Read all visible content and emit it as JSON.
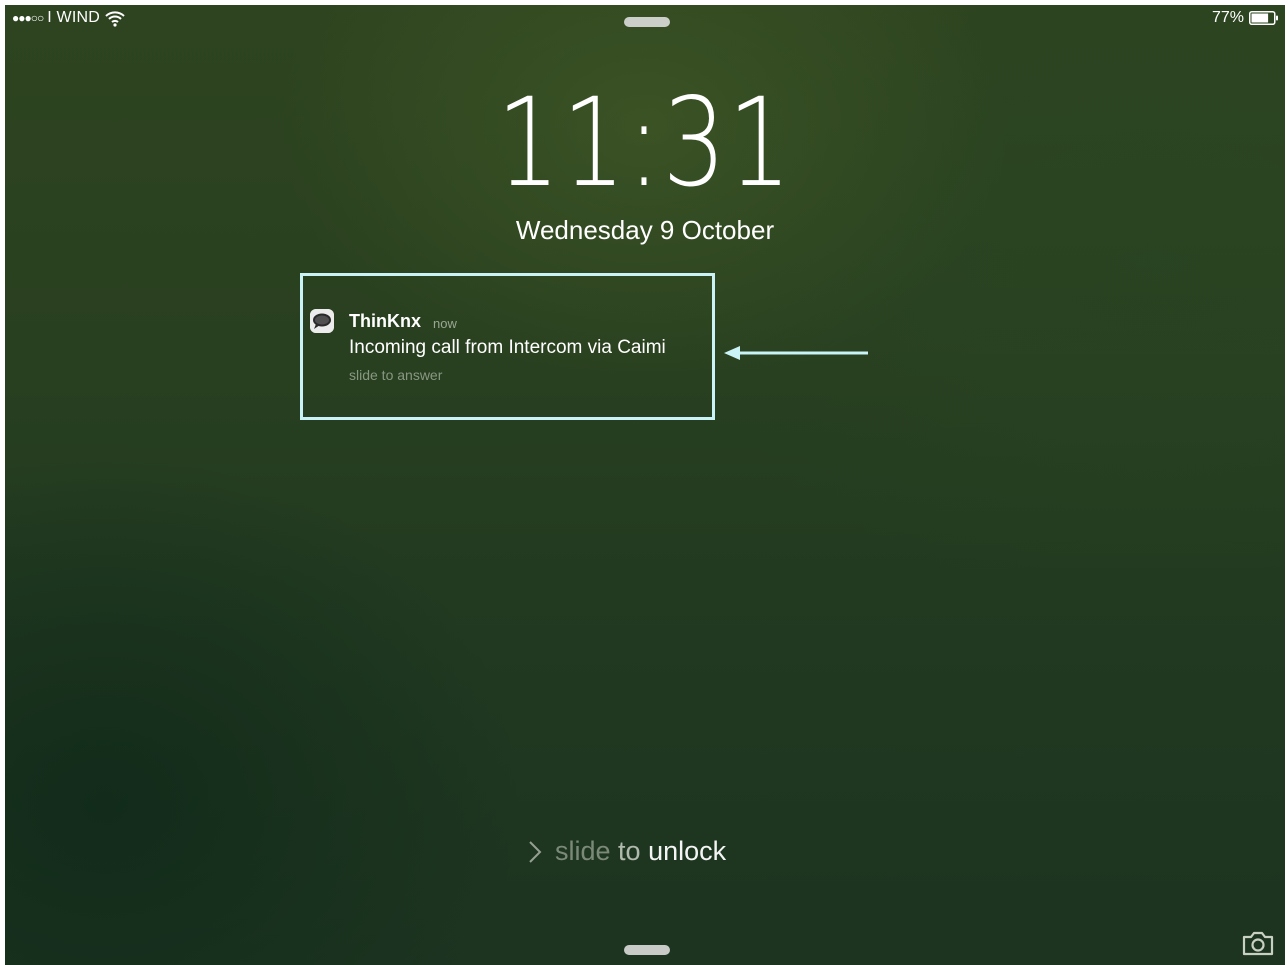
{
  "status_bar": {
    "signal": "●●●○○",
    "carrier": "I WIND",
    "battery_percent": "77%",
    "battery_level": 0.77
  },
  "lock_screen": {
    "time": "11:31",
    "date": "Wednesday 9 October"
  },
  "notification": {
    "app_name": "ThinKnx",
    "time": "now",
    "message": "Incoming call from Intercom via Caimi",
    "action": "slide to answer"
  },
  "unlock": {
    "word1": "slide",
    "word2": "to",
    "word3": "unlock"
  },
  "colors": {
    "highlight_box": "#c9f3f6",
    "arrow": "#c9f3f6"
  },
  "icons": {
    "wifi": "wifi-icon",
    "battery": "battery-icon",
    "app": "chat-bubble-icon",
    "chevron": "chevron-right-icon",
    "camera": "camera-icon"
  }
}
